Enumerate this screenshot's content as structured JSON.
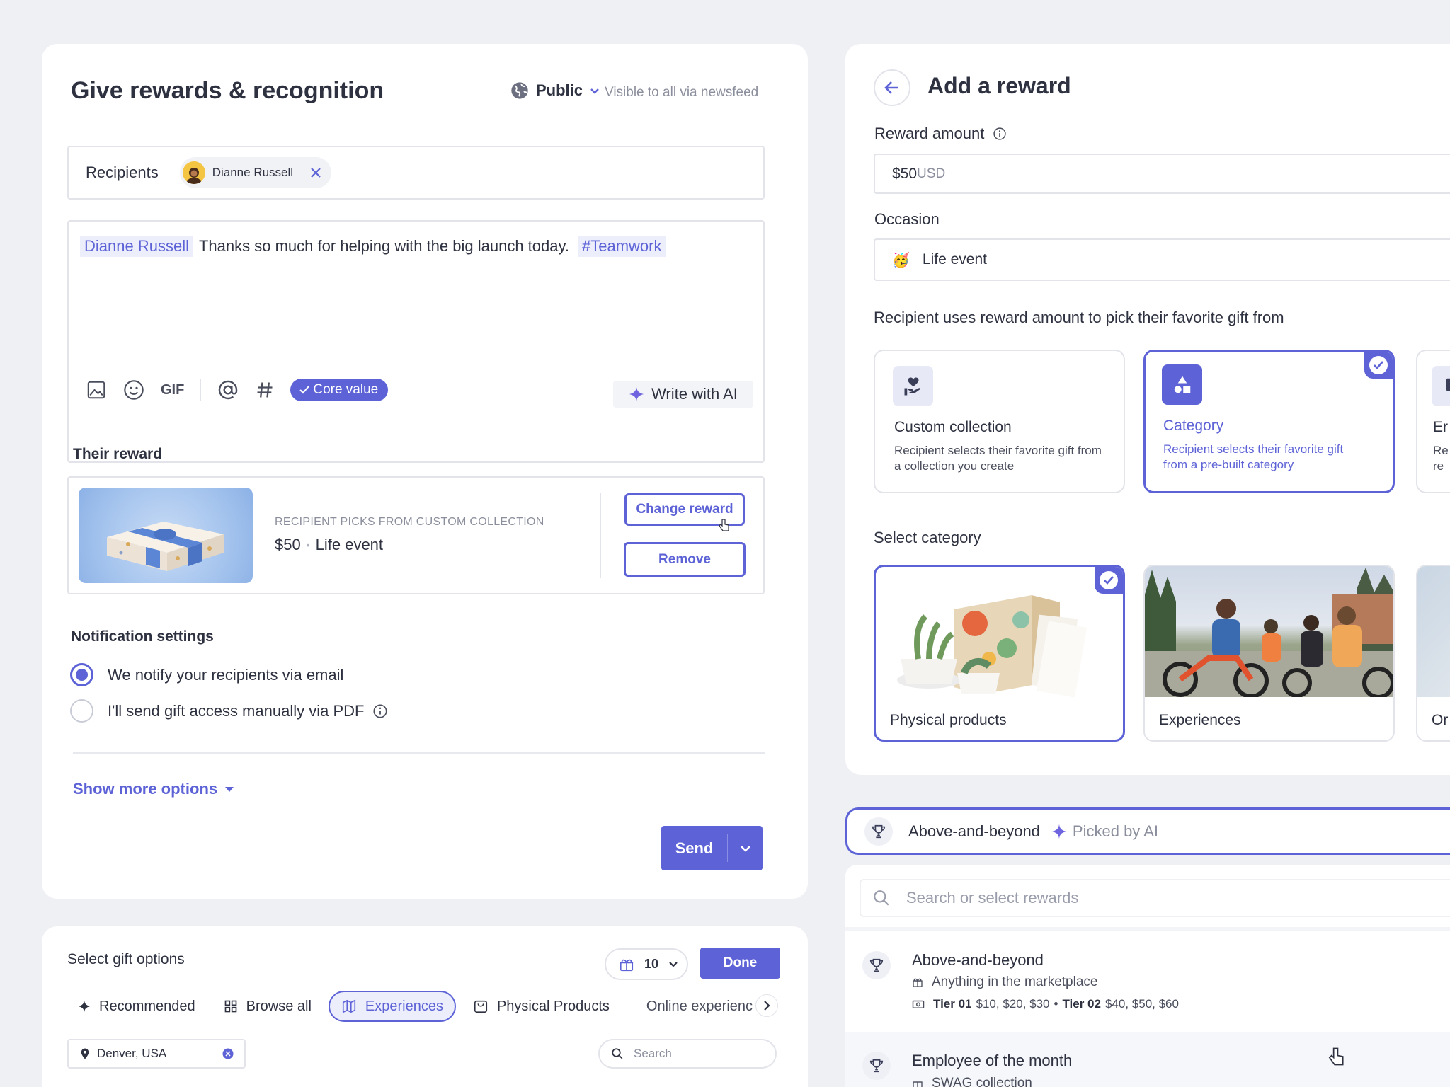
{
  "compose": {
    "title": "Give rewards & recognition",
    "visibility": "Public",
    "visibility_note": "Visible to all via newsfeed",
    "recipients_label": "Recipients",
    "recipient_chip": "Dianne Russell",
    "message_mention": "Dianne Russell",
    "message_text": "Thanks so much for helping with the big launch today.",
    "message_tag": "#Teamwork",
    "toolbar": {
      "gif": "GIF",
      "core_value": "Core value",
      "write_ai": "Write with AI"
    }
  },
  "their_reward": {
    "heading": "Their reward",
    "kicker": "RECIPIENT PICKS FROM CUSTOM COLLECTION",
    "amount": "$50",
    "separator": "•",
    "occasion": "Life event",
    "change_label": "Change reward",
    "remove_label": "Remove"
  },
  "notifications": {
    "heading": "Notification settings",
    "options": [
      "We notify your recipients via email",
      "I'll send gift access manually via PDF"
    ],
    "selected_index": 0
  },
  "show_more": "Show more options",
  "send_label": "Send",
  "gift_options": {
    "title": "Select gift options",
    "count": "10",
    "done": "Done",
    "tabs": [
      "Recommended",
      "Browse all",
      "Experiences",
      "Physical Products",
      "Online experienc"
    ],
    "active_tab": "Experiences",
    "location": "Denver, USA",
    "search_placeholder": "Search"
  },
  "add_reward": {
    "title": "Add a reward",
    "amount_label": "Reward amount",
    "amount_value": "$50",
    "amount_currency": "USD",
    "occasion_label": "Occasion",
    "occasion_emoji": "🥳",
    "occasion_value": "Life event",
    "gift_from_label": "Recipient uses reward amount to pick their favorite gift from",
    "gift_types": [
      {
        "title": "Custom collection",
        "desc": "Recipient selects their favorite gift from a collection you create",
        "selected": false
      },
      {
        "title": "Category",
        "desc": "Recipient selects their favorite gift from a pre-built category",
        "selected": true
      },
      {
        "title": "Er",
        "desc": "Re re",
        "selected": false
      }
    ],
    "select_category_label": "Select category",
    "categories": [
      {
        "title": "Physical products",
        "selected": true
      },
      {
        "title": "Experiences",
        "selected": false
      },
      {
        "title": "Or",
        "selected": false
      }
    ]
  },
  "award_picker": {
    "selected": "Above-and-beyond",
    "ai_badge": "Picked by AI",
    "search_placeholder": "Search or select rewards",
    "items": [
      {
        "title": "Above-and-beyond",
        "subtitle": "Anything in the marketplace",
        "tier1_label": "Tier 01",
        "tier1_values": "$10, $20, $30",
        "tier_sep": "•",
        "tier2_label": "Tier 02",
        "tier2_values": "$40, $50, $60"
      },
      {
        "title": "Employee of the month",
        "subtitle": "SWAG collection"
      }
    ]
  },
  "colors": {
    "accent": "#5d63d6",
    "accent_soft": "#eceefc",
    "background": "#eef0f4"
  }
}
